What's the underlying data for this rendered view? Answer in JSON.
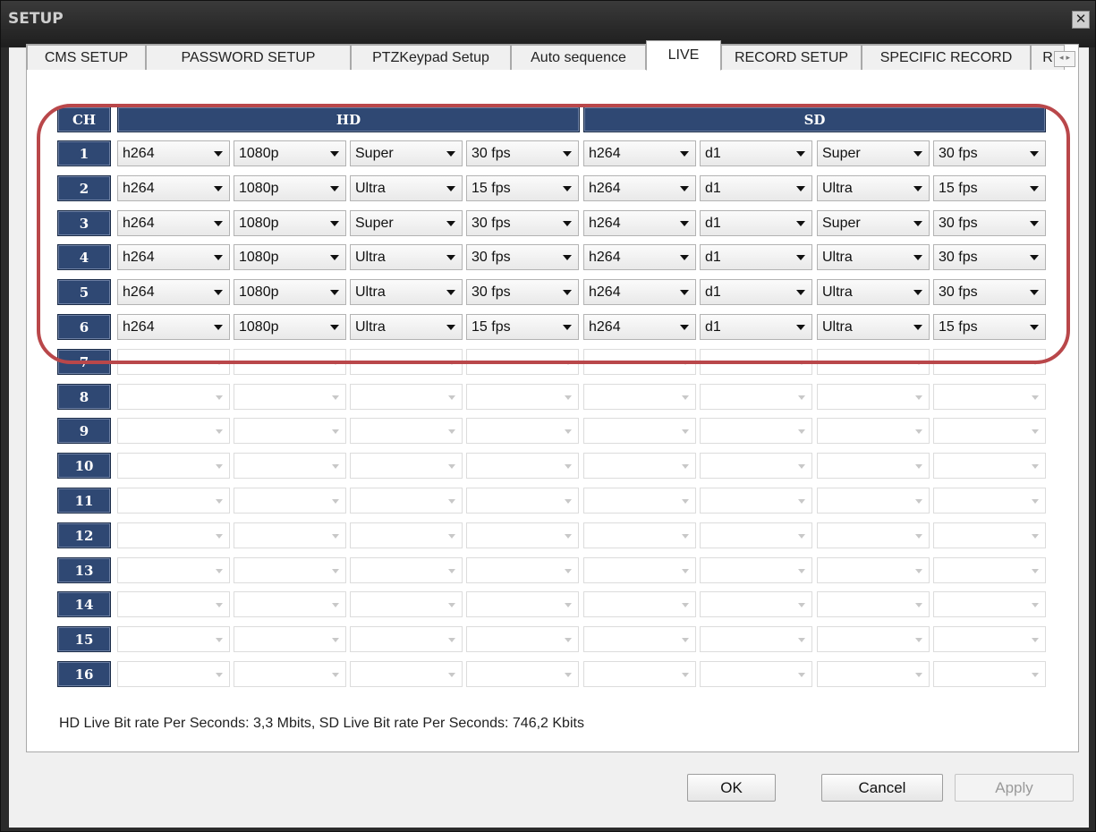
{
  "window": {
    "title": "SETUP",
    "close_glyph": "✕"
  },
  "tabs": [
    {
      "label": "CMS SETUP",
      "active": false
    },
    {
      "label": "PASSWORD SETUP",
      "active": false
    },
    {
      "label": "PTZKeypad Setup",
      "active": false
    },
    {
      "label": "Auto sequence",
      "active": false
    },
    {
      "label": "LIVE",
      "active": true
    },
    {
      "label": "RECORD SETUP",
      "active": false
    },
    {
      "label": "SPECIFIC RECORD",
      "active": false
    },
    {
      "label": "R",
      "active": false
    }
  ],
  "tab_scroll": {
    "left": "◂",
    "right": "▸"
  },
  "grid": {
    "ch_header": "CH",
    "hd_header": "HD",
    "sd_header": "SD",
    "rows": [
      {
        "ch": "1",
        "values": [
          "h264",
          "1080p",
          "Super",
          "30 fps",
          "h264",
          "d1",
          "Super",
          "30 fps"
        ]
      },
      {
        "ch": "2",
        "values": [
          "h264",
          "1080p",
          "Ultra",
          "15 fps",
          "h264",
          "d1",
          "Ultra",
          "15 fps"
        ]
      },
      {
        "ch": "3",
        "values": [
          "h264",
          "1080p",
          "Super",
          "30 fps",
          "h264",
          "d1",
          "Super",
          "30 fps"
        ]
      },
      {
        "ch": "4",
        "values": [
          "h264",
          "1080p",
          "Ultra",
          "30 fps",
          "h264",
          "d1",
          "Ultra",
          "30 fps"
        ]
      },
      {
        "ch": "5",
        "values": [
          "h264",
          "1080p",
          "Ultra",
          "30 fps",
          "h264",
          "d1",
          "Ultra",
          "30 fps"
        ]
      },
      {
        "ch": "6",
        "values": [
          "h264",
          "1080p",
          "Ultra",
          "15 fps",
          "h264",
          "d1",
          "Ultra",
          "15 fps"
        ]
      },
      {
        "ch": "7",
        "values": [
          "",
          "",
          "",
          "",
          "",
          "",
          "",
          ""
        ]
      },
      {
        "ch": "8",
        "values": [
          "",
          "",
          "",
          "",
          "",
          "",
          "",
          ""
        ]
      },
      {
        "ch": "9",
        "values": [
          "",
          "",
          "",
          "",
          "",
          "",
          "",
          ""
        ]
      },
      {
        "ch": "10",
        "values": [
          "",
          "",
          "",
          "",
          "",
          "",
          "",
          ""
        ]
      },
      {
        "ch": "11",
        "values": [
          "",
          "",
          "",
          "",
          "",
          "",
          "",
          ""
        ]
      },
      {
        "ch": "12",
        "values": [
          "",
          "",
          "",
          "",
          "",
          "",
          "",
          ""
        ]
      },
      {
        "ch": "13",
        "values": [
          "",
          "",
          "",
          "",
          "",
          "",
          "",
          ""
        ]
      },
      {
        "ch": "14",
        "values": [
          "",
          "",
          "",
          "",
          "",
          "",
          "",
          ""
        ]
      },
      {
        "ch": "15",
        "values": [
          "",
          "",
          "",
          "",
          "",
          "",
          "",
          ""
        ]
      },
      {
        "ch": "16",
        "values": [
          "",
          "",
          "",
          "",
          "",
          "",
          "",
          ""
        ]
      }
    ]
  },
  "status_text": "HD Live Bit rate Per Seconds: 3,3 Mbits, SD Live Bit rate Per Seconds: 746,2 Kbits",
  "buttons": {
    "ok": "OK",
    "cancel": "Cancel",
    "apply": "Apply"
  },
  "colors": {
    "header_bg": "#2f4873",
    "highlight": "#b9474a"
  }
}
